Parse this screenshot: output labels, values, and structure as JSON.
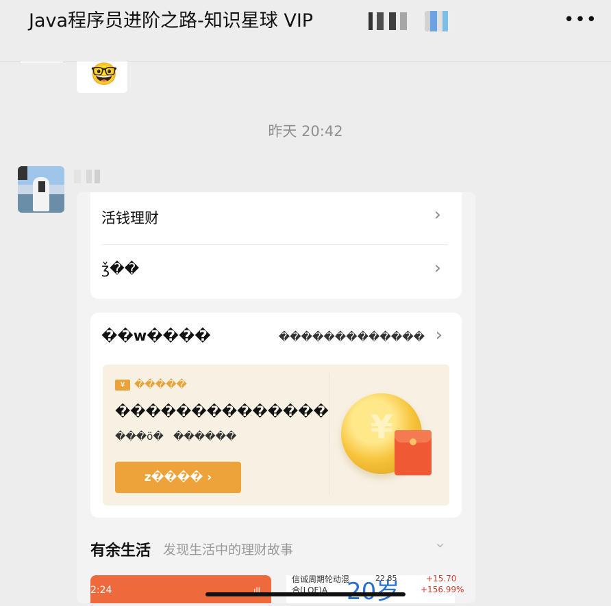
{
  "header": {
    "title": "Java程序员进阶之路-知识星球 VIP",
    "more_label": "•••"
  },
  "chat": {
    "prev_emoji": "🤓",
    "timestamp": "昨天 20:42"
  },
  "card": {
    "rows": [
      {
        "label": "活钱理财",
        "chevron": "›"
      },
      {
        "label": "ǯ��",
        "chevron": "›"
      }
    ],
    "promo_panel": {
      "heading": "��w����",
      "more_text": "�������������",
      "chevron": "›",
      "tag_icon": "¥",
      "tag_text": "�����",
      "headline": "��������������",
      "subline": "���ö�   ������",
      "cta_label": "z���� ›",
      "coin_symbol": "¥"
    },
    "section": {
      "title": "有余生活",
      "subtitle": "发现生活中的理财故事",
      "chevron": "›"
    },
    "thumbnails": {
      "left_time": "2:24",
      "left_status": "ıll",
      "fund_name": "信诚周期轮动混合(LOF)A",
      "big_text": "20岁",
      "small_number": "22.85",
      "return_top": "+15.70",
      "return_bottom": "+156.99%"
    }
  }
}
